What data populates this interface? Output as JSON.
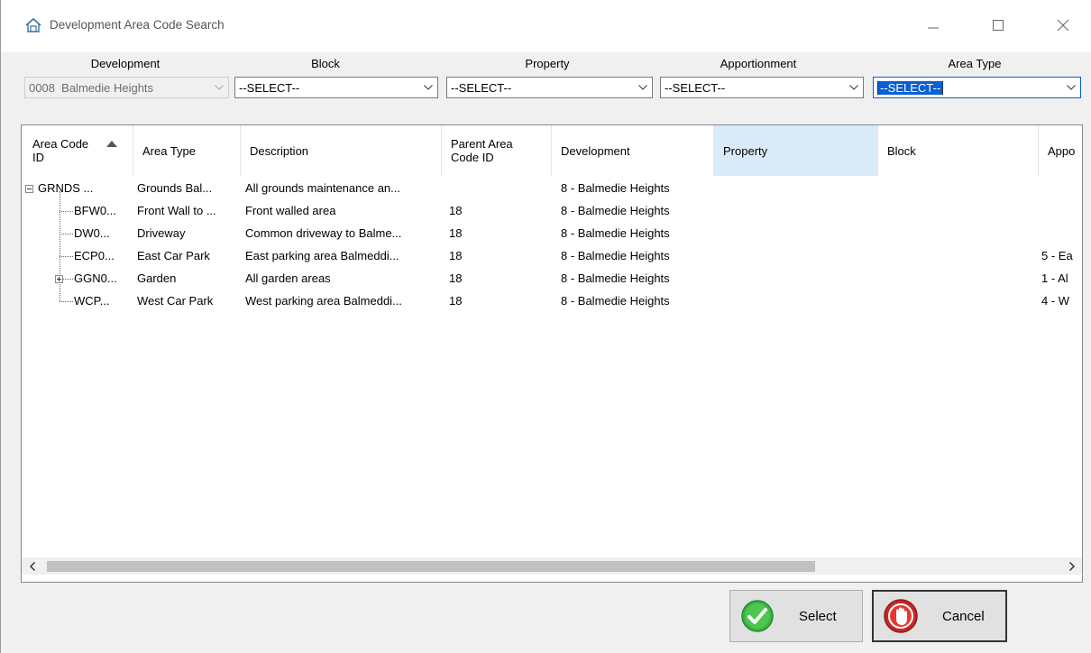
{
  "window": {
    "title": "Development Area Code Search"
  },
  "filters": {
    "development": {
      "label": "Development",
      "code": "0008",
      "value": "Balmedie Heights"
    },
    "block": {
      "label": "Block",
      "value": "--SELECT--"
    },
    "property": {
      "label": "Property",
      "value": "--SELECT--"
    },
    "apportionment": {
      "label": "Apportionment",
      "value": "--SELECT--"
    },
    "area_type": {
      "label": "Area Type",
      "value": "--SELECT--"
    }
  },
  "grid": {
    "columns": [
      {
        "key": "area_code_id",
        "label_1": "Area Code",
        "label_2": "ID"
      },
      {
        "key": "area_type",
        "label_1": "Area Type",
        "label_2": ""
      },
      {
        "key": "description",
        "label_1": "Description",
        "label_2": ""
      },
      {
        "key": "parent",
        "label_1": "Parent Area",
        "label_2": "Code ID"
      },
      {
        "key": "development",
        "label_1": "Development",
        "label_2": ""
      },
      {
        "key": "property",
        "label_1": "Property",
        "label_2": ""
      },
      {
        "key": "block",
        "label_1": "Block",
        "label_2": ""
      },
      {
        "key": "apportionment",
        "label_1": "Appo",
        "label_2": ""
      }
    ],
    "rows": [
      {
        "area_code_id": "GRNDS ...",
        "area_type": "Grounds Bal...",
        "description": "All grounds maintenance an...",
        "parent": "",
        "development": "8 - Balmedie Heights",
        "property": "",
        "block": "",
        "apportionment": ""
      },
      {
        "area_code_id": "BFW0...",
        "area_type": "Front Wall to ...",
        "description": "Front walled area",
        "parent": "18",
        "development": "8 - Balmedie Heights",
        "property": "",
        "block": "",
        "apportionment": ""
      },
      {
        "area_code_id": "DW0...",
        "area_type": "Driveway",
        "description": "Common driveway to Balme...",
        "parent": "18",
        "development": "8 - Balmedie Heights",
        "property": "",
        "block": "",
        "apportionment": ""
      },
      {
        "area_code_id": "ECP0...",
        "area_type": "East Car Park",
        "description": "East parking area Balmeddi...",
        "parent": "18",
        "development": "8 - Balmedie Heights",
        "property": "",
        "block": "",
        "apportionment": "5 - Ea"
      },
      {
        "area_code_id": "GGN0...",
        "area_type": "Garden",
        "description": "All garden areas",
        "parent": "18",
        "development": "8 - Balmedie Heights",
        "property": "",
        "block": "",
        "apportionment": "1 - Al"
      },
      {
        "area_code_id": "WCP...",
        "area_type": "West Car Park",
        "description": "West parking area Balmeddi...",
        "parent": "18",
        "development": "8 - Balmedie Heights",
        "property": "",
        "block": "",
        "apportionment": "4 - W"
      }
    ]
  },
  "buttons": {
    "select": "Select",
    "cancel": "Cancel"
  },
  "icons": {
    "app": "home-icon",
    "select": "green-check-icon",
    "cancel": "red-stop-hand-icon"
  }
}
